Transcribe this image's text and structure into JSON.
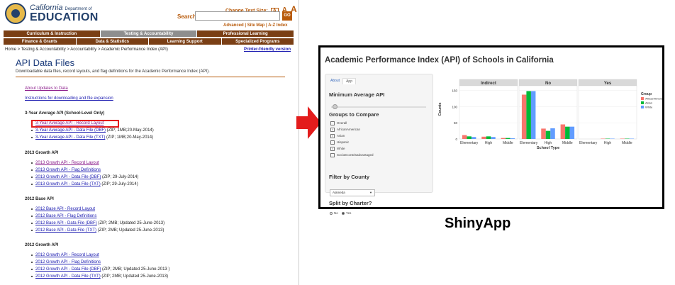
{
  "cde": {
    "logo": {
      "state": "California",
      "dept": "Department of",
      "name": "EDUCATION"
    },
    "text_size": {
      "label": "Change Text Size:",
      "a1": "A",
      "a2": "A",
      "a3": "A"
    },
    "search": {
      "label": "Search",
      "placeholder": "",
      "go": "GO"
    },
    "sublinks": "Advanced | Site Map | A-Z Index",
    "nav_row1": [
      "Curriculum & Instruction",
      "Testing & Accountability",
      "Professional Learning"
    ],
    "nav_row2": [
      "Finance & Grants",
      "Data & Statistics",
      "Learning Support",
      "Specialized Programs"
    ],
    "breadcrumb": "Home > Testing & Accountability > Accountability > Academic Performance Index (API)",
    "printer": "Printer-friendly version",
    "title": "API Data Files",
    "description": "Downloadable data files, record layouts, and flag definitions for the Academic Performance Index (API).",
    "top_links": [
      "About Updates to Data",
      "Instructions for downloading and file expansion"
    ],
    "sections": [
      {
        "heading": "3-Year Average API (School-Level Only)",
        "items": [
          {
            "link": "3-Year Average API - Record Layout",
            "suffix": ""
          },
          {
            "link": "3-Year Average API - Data File (DBF)",
            "suffix": " (ZIP; 1MB;20-May-2014)"
          },
          {
            "link": "3-Year Average API - Data File (TXT)",
            "suffix": " (ZIP; 1MB;20-May-2014)"
          }
        ]
      },
      {
        "heading": "2013 Growth API",
        "items": [
          {
            "link": "2013 Growth API - Record Layout",
            "suffix": ""
          },
          {
            "link": "2013 Growth API - Flag Definitions",
            "suffix": ""
          },
          {
            "link": "2013 Growth API - Data File (DBF)",
            "suffix": " (ZIP; 29-July-2014)"
          },
          {
            "link": "2013 Growth API - Data File (TXT)",
            "suffix": " (ZIP; 29-July-2014)"
          }
        ]
      },
      {
        "heading": "2012 Base API",
        "items": [
          {
            "link": "2012 Base API - Record Layout",
            "suffix": ""
          },
          {
            "link": "2012 Base API - Flag Definitions",
            "suffix": ""
          },
          {
            "link": "2012 Base API - Data File (DBF)",
            "suffix": " (ZIP; 2MB; Updated 25-June-2013)"
          },
          {
            "link": "2012 Base API - Data File (TXT)",
            "suffix": " (ZIP; 2MB; Updated 25-June-2013)"
          }
        ]
      },
      {
        "heading": "2012 Growth API",
        "items": [
          {
            "link": "2012 Growth API - Record Layout",
            "suffix": ""
          },
          {
            "link": "2012 Growth API - Flag Definitions",
            "suffix": ""
          },
          {
            "link": "2012 Growth API - Data File (DBF)",
            "suffix": " (ZIP; 2MB; Updated 25-June-2013 )"
          },
          {
            "link": "2012 Growth API - Data File (TXT)",
            "suffix": " (ZIP; 2MB; Updated 25-June-2013)"
          }
        ]
      }
    ]
  },
  "shiny": {
    "title": "Academic Performance Index (API) of Schools in California",
    "tabs": [
      "About",
      "App"
    ],
    "min_api_label": "Minimum Average API",
    "groups_label": "Groups to Compare",
    "groups": [
      {
        "label": "Overall",
        "checked": false
      },
      {
        "label": "AfricanAmerican",
        "checked": true
      },
      {
        "label": "Asian",
        "checked": true
      },
      {
        "label": "Hispanic",
        "checked": false
      },
      {
        "label": "White",
        "checked": true
      },
      {
        "label": "SocioEconDisadvantaged",
        "checked": false
      }
    ],
    "county_label": "Filter by County",
    "county_value": "Alameda",
    "charter_label": "Split by Charter?",
    "charter_options": [
      "No",
      "Yes"
    ],
    "charter_selected": "Yes"
  },
  "caption": "ShinyApp",
  "colors": {
    "accent": "#7a3f15",
    "arrow": "#e31c1c",
    "african": "#f8766d",
    "asian": "#00ba38",
    "white": "#619cff"
  },
  "chart_data": {
    "type": "bar",
    "facets": [
      "Indirect",
      "No",
      "Yes"
    ],
    "categories": [
      "Elementary",
      "High",
      "Middle"
    ],
    "xlabel": "School Type",
    "ylabel": "Counts",
    "yticks": [
      0,
      50,
      100,
      150
    ],
    "legend_title": "Group",
    "series": [
      {
        "name": "AfricanAmerican",
        "values": {
          "Indirect": [
            12,
            7,
            3
          ],
          "No": [
            137,
            32,
            45
          ],
          "Yes": [
            0,
            1,
            1
          ]
        }
      },
      {
        "name": "Asian",
        "values": {
          "Indirect": [
            8,
            8,
            3
          ],
          "No": [
            148,
            25,
            38
          ],
          "Yes": [
            0,
            1,
            1
          ]
        }
      },
      {
        "name": "White",
        "values": {
          "Indirect": [
            6,
            6,
            2
          ],
          "No": [
            148,
            33,
            38
          ],
          "Yes": [
            0,
            1,
            1
          ]
        }
      }
    ],
    "grid": true,
    "legend_position": "right"
  }
}
